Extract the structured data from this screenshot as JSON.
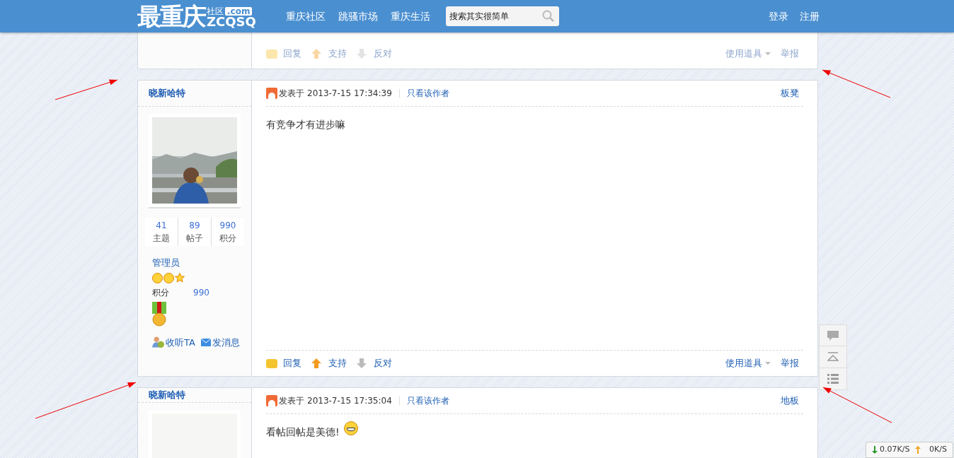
{
  "header": {
    "logo": {
      "main": "最重庆",
      "sub": "社区",
      "domain": ".com",
      "latin": "ZCQSQ"
    },
    "nav": [
      {
        "label": "重庆社区"
      },
      {
        "label": "跳骚市场"
      },
      {
        "label": "重庆生活"
      }
    ],
    "search": {
      "placeholder": "搜索其实很简单"
    },
    "account": [
      "登录",
      "注册"
    ]
  },
  "posts": [
    {
      "kind": "partial",
      "dimmed": true,
      "actions": [
        "回复",
        "支持",
        "反对"
      ],
      "tools": "使用道具",
      "report": "举报"
    },
    {
      "kind": "full",
      "dimmed": false,
      "author": "晓新哈特",
      "posted": "发表于",
      "time": "2013-7-15 17:34:39",
      "only_author": "只看该作者",
      "floor": "板凳",
      "stats": [
        {
          "value": "41",
          "label": "主题"
        },
        {
          "value": "89",
          "label": "帖子"
        },
        {
          "value": "990",
          "label": "积分"
        }
      ],
      "group": "管理员",
      "points_label": "积分",
      "points": "990",
      "user_links": [
        "收听TA",
        "发消息"
      ],
      "body": "有竞争才有进步嘛",
      "emoji": false,
      "actions": [
        "回复",
        "支持",
        "反对"
      ],
      "tools": "使用道具",
      "report": "举报"
    },
    {
      "kind": "top",
      "author": "晓新哈特",
      "posted": "发表于",
      "time": "2013-7-15 17:35:04",
      "only_author": "只看该作者",
      "floor": "地板",
      "body": "看帖回帖是美德!",
      "emoji": true
    }
  ],
  "speed": {
    "down": "0.07K/S",
    "up": "0K/S"
  }
}
